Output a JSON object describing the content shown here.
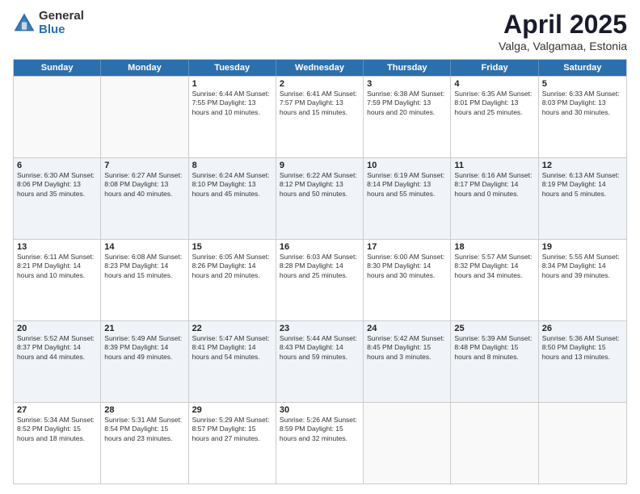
{
  "header": {
    "logo_general": "General",
    "logo_blue": "Blue",
    "title": "April 2025",
    "location": "Valga, Valgamaa, Estonia"
  },
  "days_of_week": [
    "Sunday",
    "Monday",
    "Tuesday",
    "Wednesday",
    "Thursday",
    "Friday",
    "Saturday"
  ],
  "rows": [
    [
      {
        "day": "",
        "text": "",
        "empty": true
      },
      {
        "day": "",
        "text": "",
        "empty": true
      },
      {
        "day": "1",
        "text": "Sunrise: 6:44 AM\nSunset: 7:55 PM\nDaylight: 13 hours\nand 10 minutes."
      },
      {
        "day": "2",
        "text": "Sunrise: 6:41 AM\nSunset: 7:57 PM\nDaylight: 13 hours\nand 15 minutes."
      },
      {
        "day": "3",
        "text": "Sunrise: 6:38 AM\nSunset: 7:59 PM\nDaylight: 13 hours\nand 20 minutes."
      },
      {
        "day": "4",
        "text": "Sunrise: 6:35 AM\nSunset: 8:01 PM\nDaylight: 13 hours\nand 25 minutes."
      },
      {
        "day": "5",
        "text": "Sunrise: 6:33 AM\nSunset: 8:03 PM\nDaylight: 13 hours\nand 30 minutes."
      }
    ],
    [
      {
        "day": "6",
        "text": "Sunrise: 6:30 AM\nSunset: 8:06 PM\nDaylight: 13 hours\nand 35 minutes."
      },
      {
        "day": "7",
        "text": "Sunrise: 6:27 AM\nSunset: 8:08 PM\nDaylight: 13 hours\nand 40 minutes."
      },
      {
        "day": "8",
        "text": "Sunrise: 6:24 AM\nSunset: 8:10 PM\nDaylight: 13 hours\nand 45 minutes."
      },
      {
        "day": "9",
        "text": "Sunrise: 6:22 AM\nSunset: 8:12 PM\nDaylight: 13 hours\nand 50 minutes."
      },
      {
        "day": "10",
        "text": "Sunrise: 6:19 AM\nSunset: 8:14 PM\nDaylight: 13 hours\nand 55 minutes."
      },
      {
        "day": "11",
        "text": "Sunrise: 6:16 AM\nSunset: 8:17 PM\nDaylight: 14 hours\nand 0 minutes."
      },
      {
        "day": "12",
        "text": "Sunrise: 6:13 AM\nSunset: 8:19 PM\nDaylight: 14 hours\nand 5 minutes."
      }
    ],
    [
      {
        "day": "13",
        "text": "Sunrise: 6:11 AM\nSunset: 8:21 PM\nDaylight: 14 hours\nand 10 minutes."
      },
      {
        "day": "14",
        "text": "Sunrise: 6:08 AM\nSunset: 8:23 PM\nDaylight: 14 hours\nand 15 minutes."
      },
      {
        "day": "15",
        "text": "Sunrise: 6:05 AM\nSunset: 8:26 PM\nDaylight: 14 hours\nand 20 minutes."
      },
      {
        "day": "16",
        "text": "Sunrise: 6:03 AM\nSunset: 8:28 PM\nDaylight: 14 hours\nand 25 minutes."
      },
      {
        "day": "17",
        "text": "Sunrise: 6:00 AM\nSunset: 8:30 PM\nDaylight: 14 hours\nand 30 minutes."
      },
      {
        "day": "18",
        "text": "Sunrise: 5:57 AM\nSunset: 8:32 PM\nDaylight: 14 hours\nand 34 minutes."
      },
      {
        "day": "19",
        "text": "Sunrise: 5:55 AM\nSunset: 8:34 PM\nDaylight: 14 hours\nand 39 minutes."
      }
    ],
    [
      {
        "day": "20",
        "text": "Sunrise: 5:52 AM\nSunset: 8:37 PM\nDaylight: 14 hours\nand 44 minutes."
      },
      {
        "day": "21",
        "text": "Sunrise: 5:49 AM\nSunset: 8:39 PM\nDaylight: 14 hours\nand 49 minutes."
      },
      {
        "day": "22",
        "text": "Sunrise: 5:47 AM\nSunset: 8:41 PM\nDaylight: 14 hours\nand 54 minutes."
      },
      {
        "day": "23",
        "text": "Sunrise: 5:44 AM\nSunset: 8:43 PM\nDaylight: 14 hours\nand 59 minutes."
      },
      {
        "day": "24",
        "text": "Sunrise: 5:42 AM\nSunset: 8:45 PM\nDaylight: 15 hours\nand 3 minutes."
      },
      {
        "day": "25",
        "text": "Sunrise: 5:39 AM\nSunset: 8:48 PM\nDaylight: 15 hours\nand 8 minutes."
      },
      {
        "day": "26",
        "text": "Sunrise: 5:36 AM\nSunset: 8:50 PM\nDaylight: 15 hours\nand 13 minutes."
      }
    ],
    [
      {
        "day": "27",
        "text": "Sunrise: 5:34 AM\nSunset: 8:52 PM\nDaylight: 15 hours\nand 18 minutes."
      },
      {
        "day": "28",
        "text": "Sunrise: 5:31 AM\nSunset: 8:54 PM\nDaylight: 15 hours\nand 23 minutes."
      },
      {
        "day": "29",
        "text": "Sunrise: 5:29 AM\nSunset: 8:57 PM\nDaylight: 15 hours\nand 27 minutes."
      },
      {
        "day": "30",
        "text": "Sunrise: 5:26 AM\nSunset: 8:59 PM\nDaylight: 15 hours\nand 32 minutes."
      },
      {
        "day": "",
        "text": "",
        "empty": true
      },
      {
        "day": "",
        "text": "",
        "empty": true
      },
      {
        "day": "",
        "text": "",
        "empty": true
      }
    ]
  ]
}
